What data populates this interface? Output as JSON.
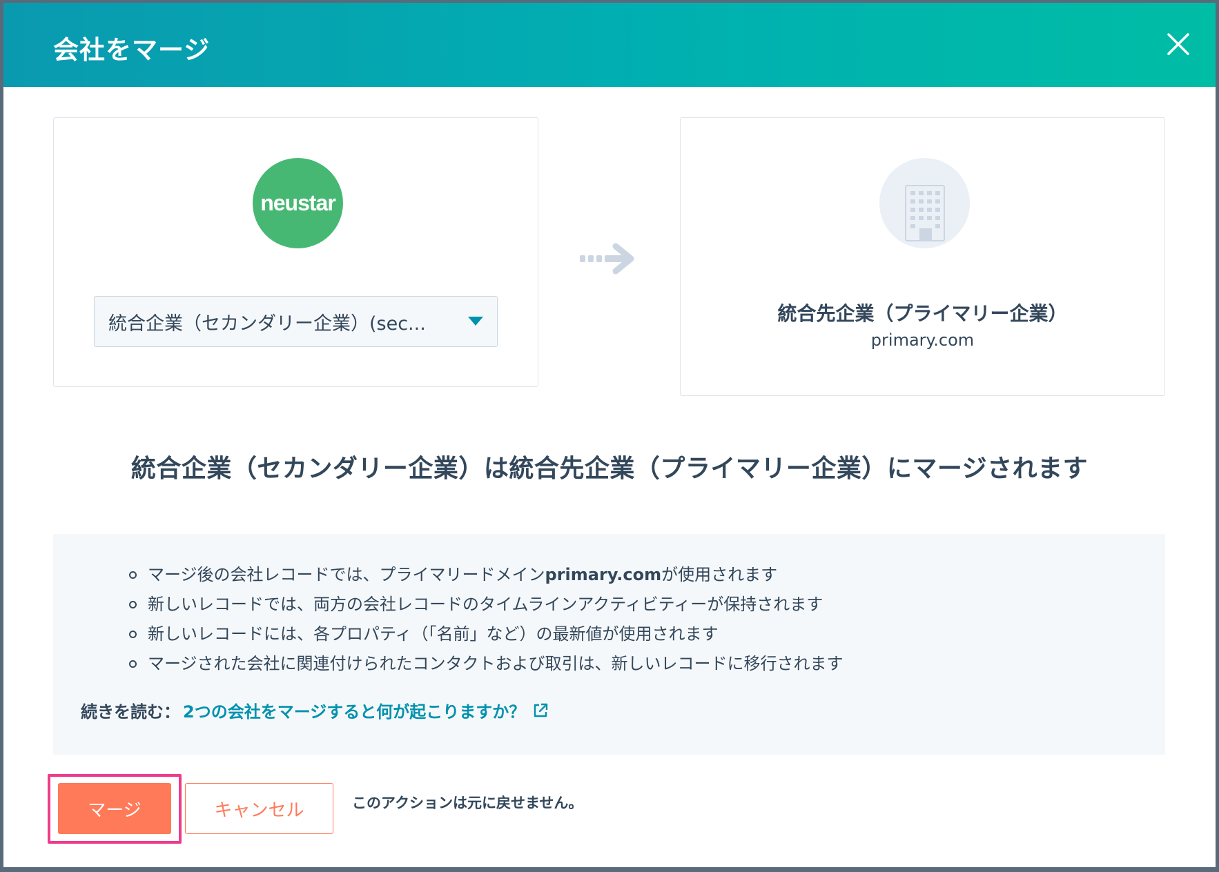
{
  "dialog": {
    "title": "会社をマージ",
    "close_icon": "close-icon"
  },
  "secondary": {
    "logo_text": "neustar",
    "logo_color": "#47b873",
    "select_value": "統合企業（セカンダリー企業）(sec..."
  },
  "primary": {
    "icon": "building-icon",
    "name": "統合先企業（プライマリー企業）",
    "domain": "primary.com"
  },
  "headline": "統合企業（セカンダリー企業）は統合先企業（プライマリー企業）にマージされます",
  "info": {
    "items": [
      {
        "before": "マージ後の会社レコードでは、プライマリードメイン",
        "bold": "primary.com",
        "after": "が使用されます"
      },
      {
        "before": "新しいレコードでは、両方の会社レコードのタイムラインアクティビティーが保持されます",
        "bold": "",
        "after": ""
      },
      {
        "before": "新しいレコードには、各プロパティ（「名前」など）の最新値が使用されます",
        "bold": "",
        "after": ""
      },
      {
        "before": "マージされた会社に関連付けられたコンタクトおよび取引は、新しいレコードに移行されます",
        "bold": "",
        "after": ""
      }
    ],
    "readmore_label": "続きを読む：",
    "readmore_link": "2つの会社をマージすると何が起こりますか？"
  },
  "actions": {
    "merge_label": "マージ",
    "cancel_label": "キャンセル",
    "note": "このアクションは元に戻せません。"
  },
  "colors": {
    "accent": "#ff7a59",
    "link": "#0091ae",
    "highlight": "#ee3b8a",
    "header_start": "#0a9ab0",
    "header_end": "#00bda5"
  }
}
